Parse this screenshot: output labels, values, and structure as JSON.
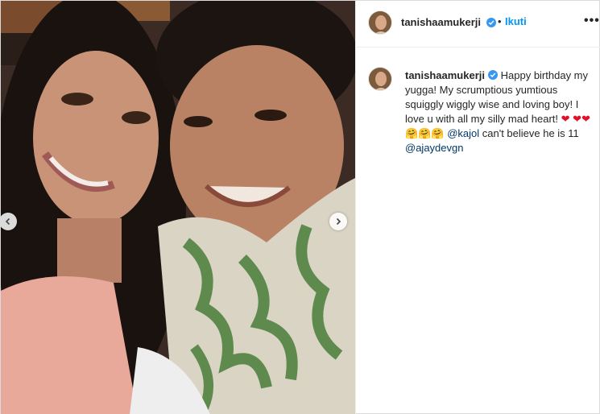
{
  "post": {
    "username": "tanishaamukerji",
    "follow_label": "Ikuti",
    "separator": "•",
    "more_label": "•••",
    "caption": {
      "username": "tanishaamukerji",
      "text_part1": "Happy birthday my yugga! My scrumptious yumtious squiggly wiggly wise and loving boy! I love u with all my silly mad heart!",
      "heart_emoji": "❤",
      "hug_emoji": "🤗",
      "mention1": "@kajol",
      "text_part2": "can't believe he is 11",
      "mention2": "@ajaydevgn"
    }
  },
  "icons": {
    "verified": "verified-badge-icon",
    "prev": "chevron-left-icon",
    "next": "chevron-right-icon"
  },
  "colors": {
    "accent": "#0095f6",
    "text": "#262626",
    "mention": "#00376b",
    "verified": "#3897f0"
  }
}
